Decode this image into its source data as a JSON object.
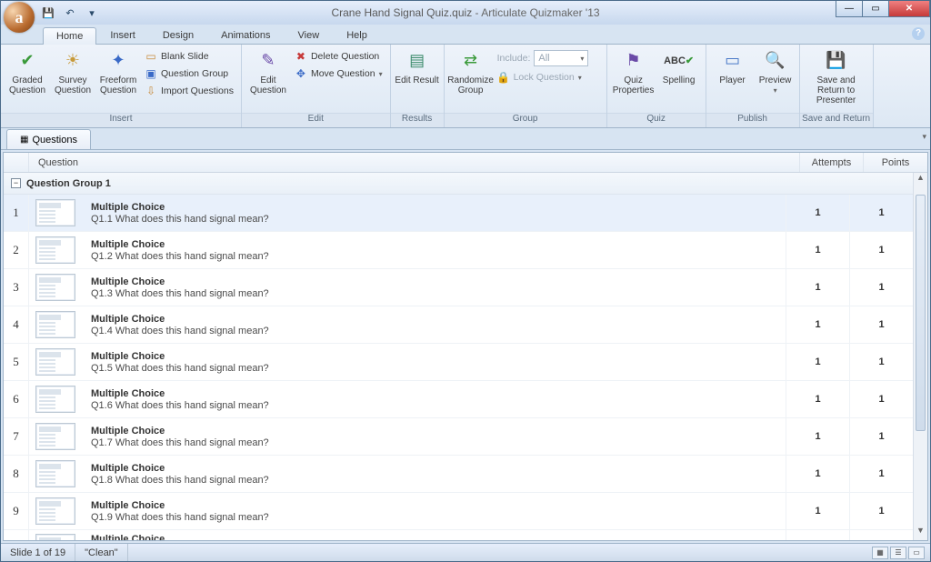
{
  "window": {
    "filename": "Crane Hand Signal Quiz.quiz",
    "app": "Articulate Quizmaker '13"
  },
  "qat": {
    "save": "💾",
    "undo": "↶",
    "redo_dd": "▾"
  },
  "menu": {
    "tabs": [
      "Home",
      "Insert",
      "Design",
      "Animations",
      "View",
      "Help"
    ],
    "active": "Home"
  },
  "ribbon": {
    "insert": {
      "graded": "Graded Question",
      "survey": "Survey Question",
      "freeform": "Freeform Question",
      "blank": "Blank Slide",
      "qgroup": "Question Group",
      "import": "Import Questions",
      "label": "Insert"
    },
    "edit": {
      "editq": "Edit Question",
      "del": "Delete Question",
      "move": "Move Question",
      "label": "Edit"
    },
    "results": {
      "editr": "Edit Result",
      "label": "Results"
    },
    "group": {
      "rand": "Randomize Group",
      "incl": "Include:",
      "incl_val": "All",
      "lock": "Lock Question",
      "label": "Group"
    },
    "quiz": {
      "props": "Quiz Properties",
      "spell": "Spelling",
      "label": "Quiz"
    },
    "publish": {
      "player": "Player",
      "preview": "Preview",
      "label": "Publish"
    },
    "save": {
      "save": "Save and Return to Presenter",
      "label": "Save and Return"
    }
  },
  "docTab": "Questions",
  "columns": {
    "q": "Question",
    "a": "Attempts",
    "p": "Points"
  },
  "groupName": "Question Group 1",
  "rows": [
    {
      "n": "1",
      "type": "Multiple Choice",
      "text": "Q1.1 What does this hand signal mean?",
      "a": "1",
      "p": "1",
      "sel": true
    },
    {
      "n": "2",
      "type": "Multiple Choice",
      "text": "Q1.2 What does this hand signal mean?",
      "a": "1",
      "p": "1"
    },
    {
      "n": "3",
      "type": "Multiple Choice",
      "text": "Q1.3 What does this hand signal mean?",
      "a": "1",
      "p": "1"
    },
    {
      "n": "4",
      "type": "Multiple Choice",
      "text": "Q1.4 What does this hand signal mean?",
      "a": "1",
      "p": "1"
    },
    {
      "n": "5",
      "type": "Multiple Choice",
      "text": "Q1.5 What does this hand signal mean?",
      "a": "1",
      "p": "1"
    },
    {
      "n": "6",
      "type": "Multiple Choice",
      "text": "Q1.6 What does this hand signal mean?",
      "a": "1",
      "p": "1"
    },
    {
      "n": "7",
      "type": "Multiple Choice",
      "text": "Q1.7 What does this hand signal mean?",
      "a": "1",
      "p": "1"
    },
    {
      "n": "8",
      "type": "Multiple Choice",
      "text": "Q1.8 What does this hand signal mean?",
      "a": "1",
      "p": "1"
    },
    {
      "n": "9",
      "type": "Multiple Choice",
      "text": "Q1.9 What does this hand signal mean?",
      "a": "1",
      "p": "1"
    }
  ],
  "partial": {
    "type": "Multiple Choice"
  },
  "status": {
    "slide": "Slide 1 of 19",
    "theme": "\"Clean\""
  }
}
